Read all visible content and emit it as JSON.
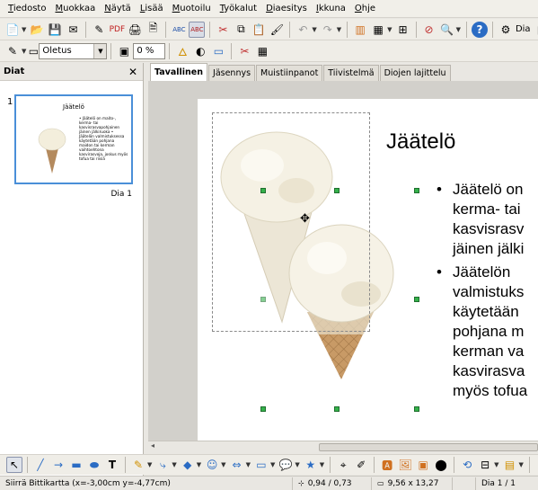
{
  "menu": [
    "Tiedosto",
    "Muokkaa",
    "Näytä",
    "Lisää",
    "Muotoilu",
    "Työkalut",
    "Diaesitys",
    "Ikkuna",
    "Ohje"
  ],
  "toolbar": {
    "dia_label": "Dia",
    "style_value": "Oletus",
    "transparency_value": "0 %"
  },
  "panel": {
    "title": "Diat",
    "slide_number": "1",
    "slide_label": "Dia 1",
    "thumb_title": "Jäätelö",
    "thumb_text": "• Jäätelö on maito-, kerma- tai kasvisrasvapohjainen jäinen jälkiruoka • Jäätelön valmistuksessa käytetään pohjana maidon tai kerman vaihtoehtona kasvirasvoja, joskus myös tofua tai riisiä"
  },
  "tabs": [
    "Tavallinen",
    "Jäsennys",
    "Muistiinpanot",
    "Tiivistelmä",
    "Diojen lajittelu"
  ],
  "slide": {
    "title": "Jäätelö",
    "bullets": [
      [
        "Jäätelö on",
        "kerma- tai",
        "kasvisrasv",
        "jäinen jälki"
      ],
      [
        "Jäätelön",
        "valmistuks",
        "käytetään",
        "pohjana m",
        "kerman va",
        "kasvirasva",
        "myös tofua"
      ]
    ]
  },
  "status": {
    "message": "Siirrä Bittikartta (x=-3,00cm y=-4,77cm)",
    "position": "0,94 / 0,73",
    "size": "9,56 x 13,27",
    "slide": "Dia 1 / 1"
  },
  "colors": {
    "accent": "#4a8fd8",
    "handle": "#35b14b"
  },
  "icons": {
    "cursor": "move-cursor-icon"
  }
}
